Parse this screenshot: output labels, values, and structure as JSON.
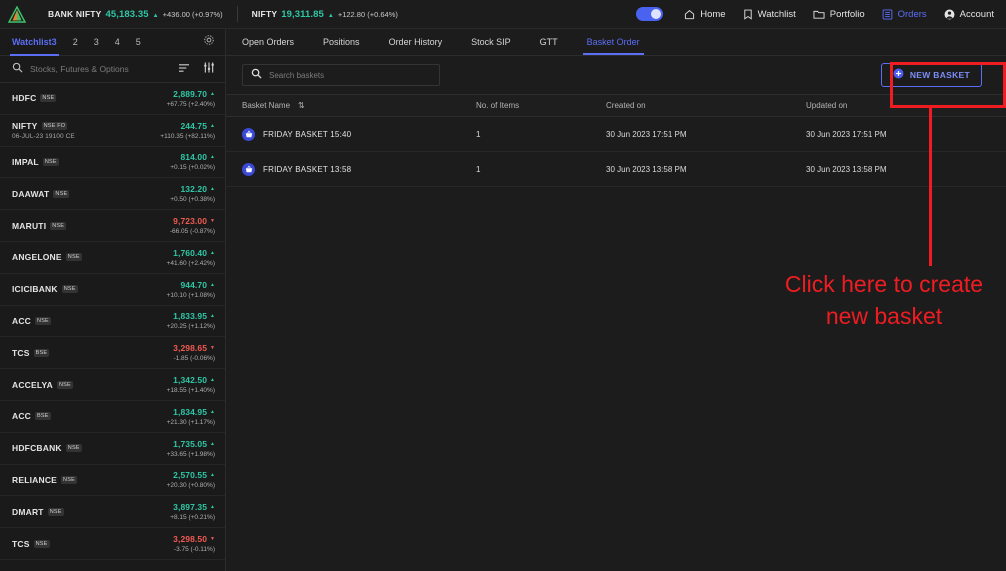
{
  "topbar": {
    "logo_icon": "angel-triangle-logo",
    "indices": [
      {
        "name": "BANK NIFTY",
        "value": "45,183.35",
        "arrow": "▲",
        "change": "+436.00 (+0.97%)",
        "dir": "up"
      },
      {
        "name": "NIFTY",
        "value": "19,311.85",
        "arrow": "▲",
        "change": "+122.80 (+0.64%)",
        "dir": "up"
      }
    ],
    "nav": [
      {
        "label": "Home",
        "icon": "home-icon",
        "active": false
      },
      {
        "label": "Watchlist",
        "icon": "bookmark-icon",
        "active": false
      },
      {
        "label": "Portfolio",
        "icon": "folder-icon",
        "active": false
      },
      {
        "label": "Orders",
        "icon": "orders-list-icon",
        "active": true
      },
      {
        "label": "Account",
        "icon": "account-person-icon",
        "active": false
      }
    ]
  },
  "sidebar": {
    "tabs": [
      {
        "label": "Watchlist3",
        "active": true
      },
      {
        "label": "2",
        "active": false
      },
      {
        "label": "3",
        "active": false
      },
      {
        "label": "4",
        "active": false
      },
      {
        "label": "5",
        "active": false
      }
    ],
    "settings_icon": "gear-icon",
    "search": {
      "placeholder": "Stocks, Futures & Options",
      "icon": "search-icon"
    },
    "sort_icon": "sort-icon",
    "filter_icon": "sliders-icon",
    "rows": [
      {
        "symbol": "HDFC",
        "exchange": "NSE",
        "sub": "",
        "price": "2,889.70",
        "arrow": "▲",
        "change": "+67.75 (+2.40%)",
        "dir": "up"
      },
      {
        "symbol": "NIFTY",
        "exchange": "NSE FO",
        "sub": "06-JUL-23 19100 CE",
        "price": "244.75",
        "arrow": "▲",
        "change": "+110.35 (+82.11%)",
        "dir": "up"
      },
      {
        "symbol": "IMPAL",
        "exchange": "NSE",
        "sub": "",
        "price": "814.00",
        "arrow": "▲",
        "change": "+0.15 (+0.02%)",
        "dir": "up"
      },
      {
        "symbol": "DAAWAT",
        "exchange": "NSE",
        "sub": "",
        "price": "132.20",
        "arrow": "▲",
        "change": "+0.50 (+0.38%)",
        "dir": "up"
      },
      {
        "symbol": "MARUTI",
        "exchange": "NSE",
        "sub": "",
        "price": "9,723.00",
        "arrow": "▼",
        "change": "-66.05 (-0.87%)",
        "dir": "down"
      },
      {
        "symbol": "ANGELONE",
        "exchange": "NSE",
        "sub": "",
        "price": "1,760.40",
        "arrow": "▲",
        "change": "+41.60 (+2.42%)",
        "dir": "up"
      },
      {
        "symbol": "ICICIBANK",
        "exchange": "NSE",
        "sub": "",
        "price": "944.70",
        "arrow": "▲",
        "change": "+10.10 (+1.08%)",
        "dir": "up"
      },
      {
        "symbol": "ACC",
        "exchange": "NSE",
        "sub": "",
        "price": "1,833.95",
        "arrow": "▲",
        "change": "+20.25 (+1.12%)",
        "dir": "up"
      },
      {
        "symbol": "TCS",
        "exchange": "BSE",
        "sub": "",
        "price": "3,298.65",
        "arrow": "▼",
        "change": "-1.85 (-0.06%)",
        "dir": "down"
      },
      {
        "symbol": "ACCELYA",
        "exchange": "NSE",
        "sub": "",
        "price": "1,342.50",
        "arrow": "▲",
        "change": "+18.55 (+1.40%)",
        "dir": "up"
      },
      {
        "symbol": "ACC",
        "exchange": "BSE",
        "sub": "",
        "price": "1,834.95",
        "arrow": "▲",
        "change": "+21.30 (+1.17%)",
        "dir": "up"
      },
      {
        "symbol": "HDFCBANK",
        "exchange": "NSE",
        "sub": "",
        "price": "1,735.05",
        "arrow": "▲",
        "change": "+33.65 (+1.98%)",
        "dir": "up"
      },
      {
        "symbol": "RELIANCE",
        "exchange": "NSE",
        "sub": "",
        "price": "2,570.55",
        "arrow": "▲",
        "change": "+20.30 (+0.80%)",
        "dir": "up"
      },
      {
        "symbol": "DMART",
        "exchange": "NSE",
        "sub": "",
        "price": "3,897.35",
        "arrow": "▲",
        "change": "+8.15 (+0.21%)",
        "dir": "up"
      },
      {
        "symbol": "TCS",
        "exchange": "NSE",
        "sub": "",
        "price": "3,298.50",
        "arrow": "▼",
        "change": "-3.75 (-0.11%)",
        "dir": "down"
      }
    ]
  },
  "main": {
    "tabs": [
      {
        "label": "Open Orders",
        "active": false
      },
      {
        "label": "Positions",
        "active": false
      },
      {
        "label": "Order History",
        "active": false
      },
      {
        "label": "Stock SIP",
        "active": false
      },
      {
        "label": "GTT",
        "active": false
      },
      {
        "label": "Basket Order",
        "active": true
      }
    ],
    "search": {
      "placeholder": "Search baskets",
      "icon": "search-icon"
    },
    "new_basket_button": {
      "label": "NEW BASKET",
      "icon": "plus-circle-icon"
    },
    "table": {
      "headers": {
        "name": "Basket Name",
        "sort_glyph": "⇅",
        "items": "No. of Items",
        "created": "Created on",
        "updated": "Updated on"
      },
      "rows": [
        {
          "icon": "basket-icon",
          "name": "FRIDAY BASKET 15:40",
          "items": "1",
          "created": "30 Jun 2023 17:51 PM",
          "updated": "30 Jun 2023 17:51 PM"
        },
        {
          "icon": "basket-icon",
          "name": "FRIDAY BASKET 13:58",
          "items": "1",
          "created": "30 Jun 2023 13:58 PM",
          "updated": "30 Jun 2023 13:58 PM"
        }
      ]
    }
  },
  "annotation": {
    "text_line1": "Click here to create",
    "text_line2": "new basket",
    "color": "#ef1c22"
  },
  "colors": {
    "accent_blue": "#5b6ef5",
    "up_green": "#2ec7a6",
    "down_red": "#f05a52",
    "annotation_red": "#ef1c22",
    "background": "#1a1a1a"
  }
}
